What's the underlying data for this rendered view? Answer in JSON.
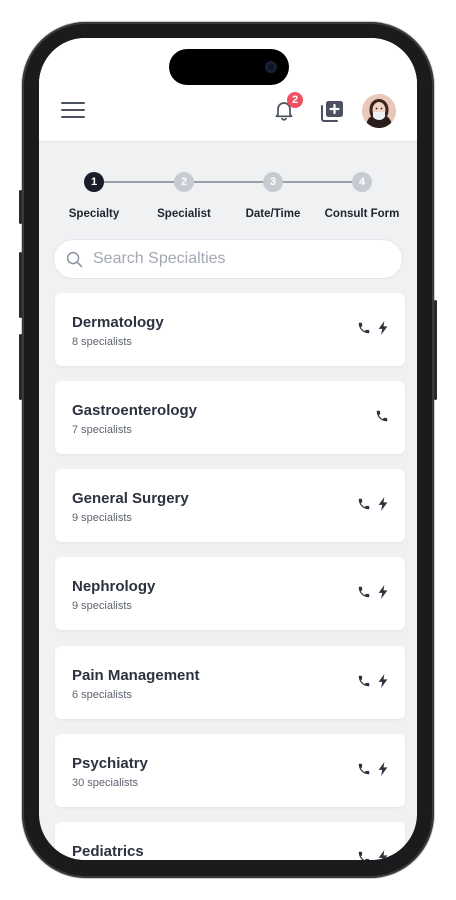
{
  "header": {
    "notification_count": "2"
  },
  "stepper": {
    "steps": [
      {
        "number": "1",
        "label": "Specialty",
        "state": "active"
      },
      {
        "number": "2",
        "label": "Specialist",
        "state": "inactive"
      },
      {
        "number": "3",
        "label": "Date/Time",
        "state": "inactive"
      },
      {
        "number": "4",
        "label": "Consult Form",
        "state": "inactive"
      }
    ]
  },
  "search": {
    "placeholder": "Search Specialties",
    "value": ""
  },
  "specialties": [
    {
      "name": "Dermatology",
      "count": "8 specialists",
      "icons": [
        "phone-icon",
        "lightning-icon"
      ]
    },
    {
      "name": "Gastroenterology",
      "count": "7 specialists",
      "icons": [
        "phone-icon"
      ]
    },
    {
      "name": "General Surgery",
      "count": "9 specialists",
      "icons": [
        "phone-icon",
        "lightning-icon"
      ]
    },
    {
      "name": "Nephrology",
      "count": "9 specialists",
      "icons": [
        "phone-icon",
        "lightning-icon"
      ]
    },
    {
      "name": "Pain Management",
      "count": "6 specialists",
      "icons": [
        "phone-icon",
        "lightning-icon"
      ]
    },
    {
      "name": "Psychiatry",
      "count": "30 specialists",
      "icons": [
        "phone-icon",
        "lightning-icon"
      ]
    },
    {
      "name": "Pediatrics",
      "count": "",
      "icons": [
        "phone-icon",
        "lightning-icon"
      ]
    }
  ],
  "colors": {
    "accent_dark": "#1a1d29",
    "badge": "#ef4f61",
    "background": "#f0f1f3"
  }
}
